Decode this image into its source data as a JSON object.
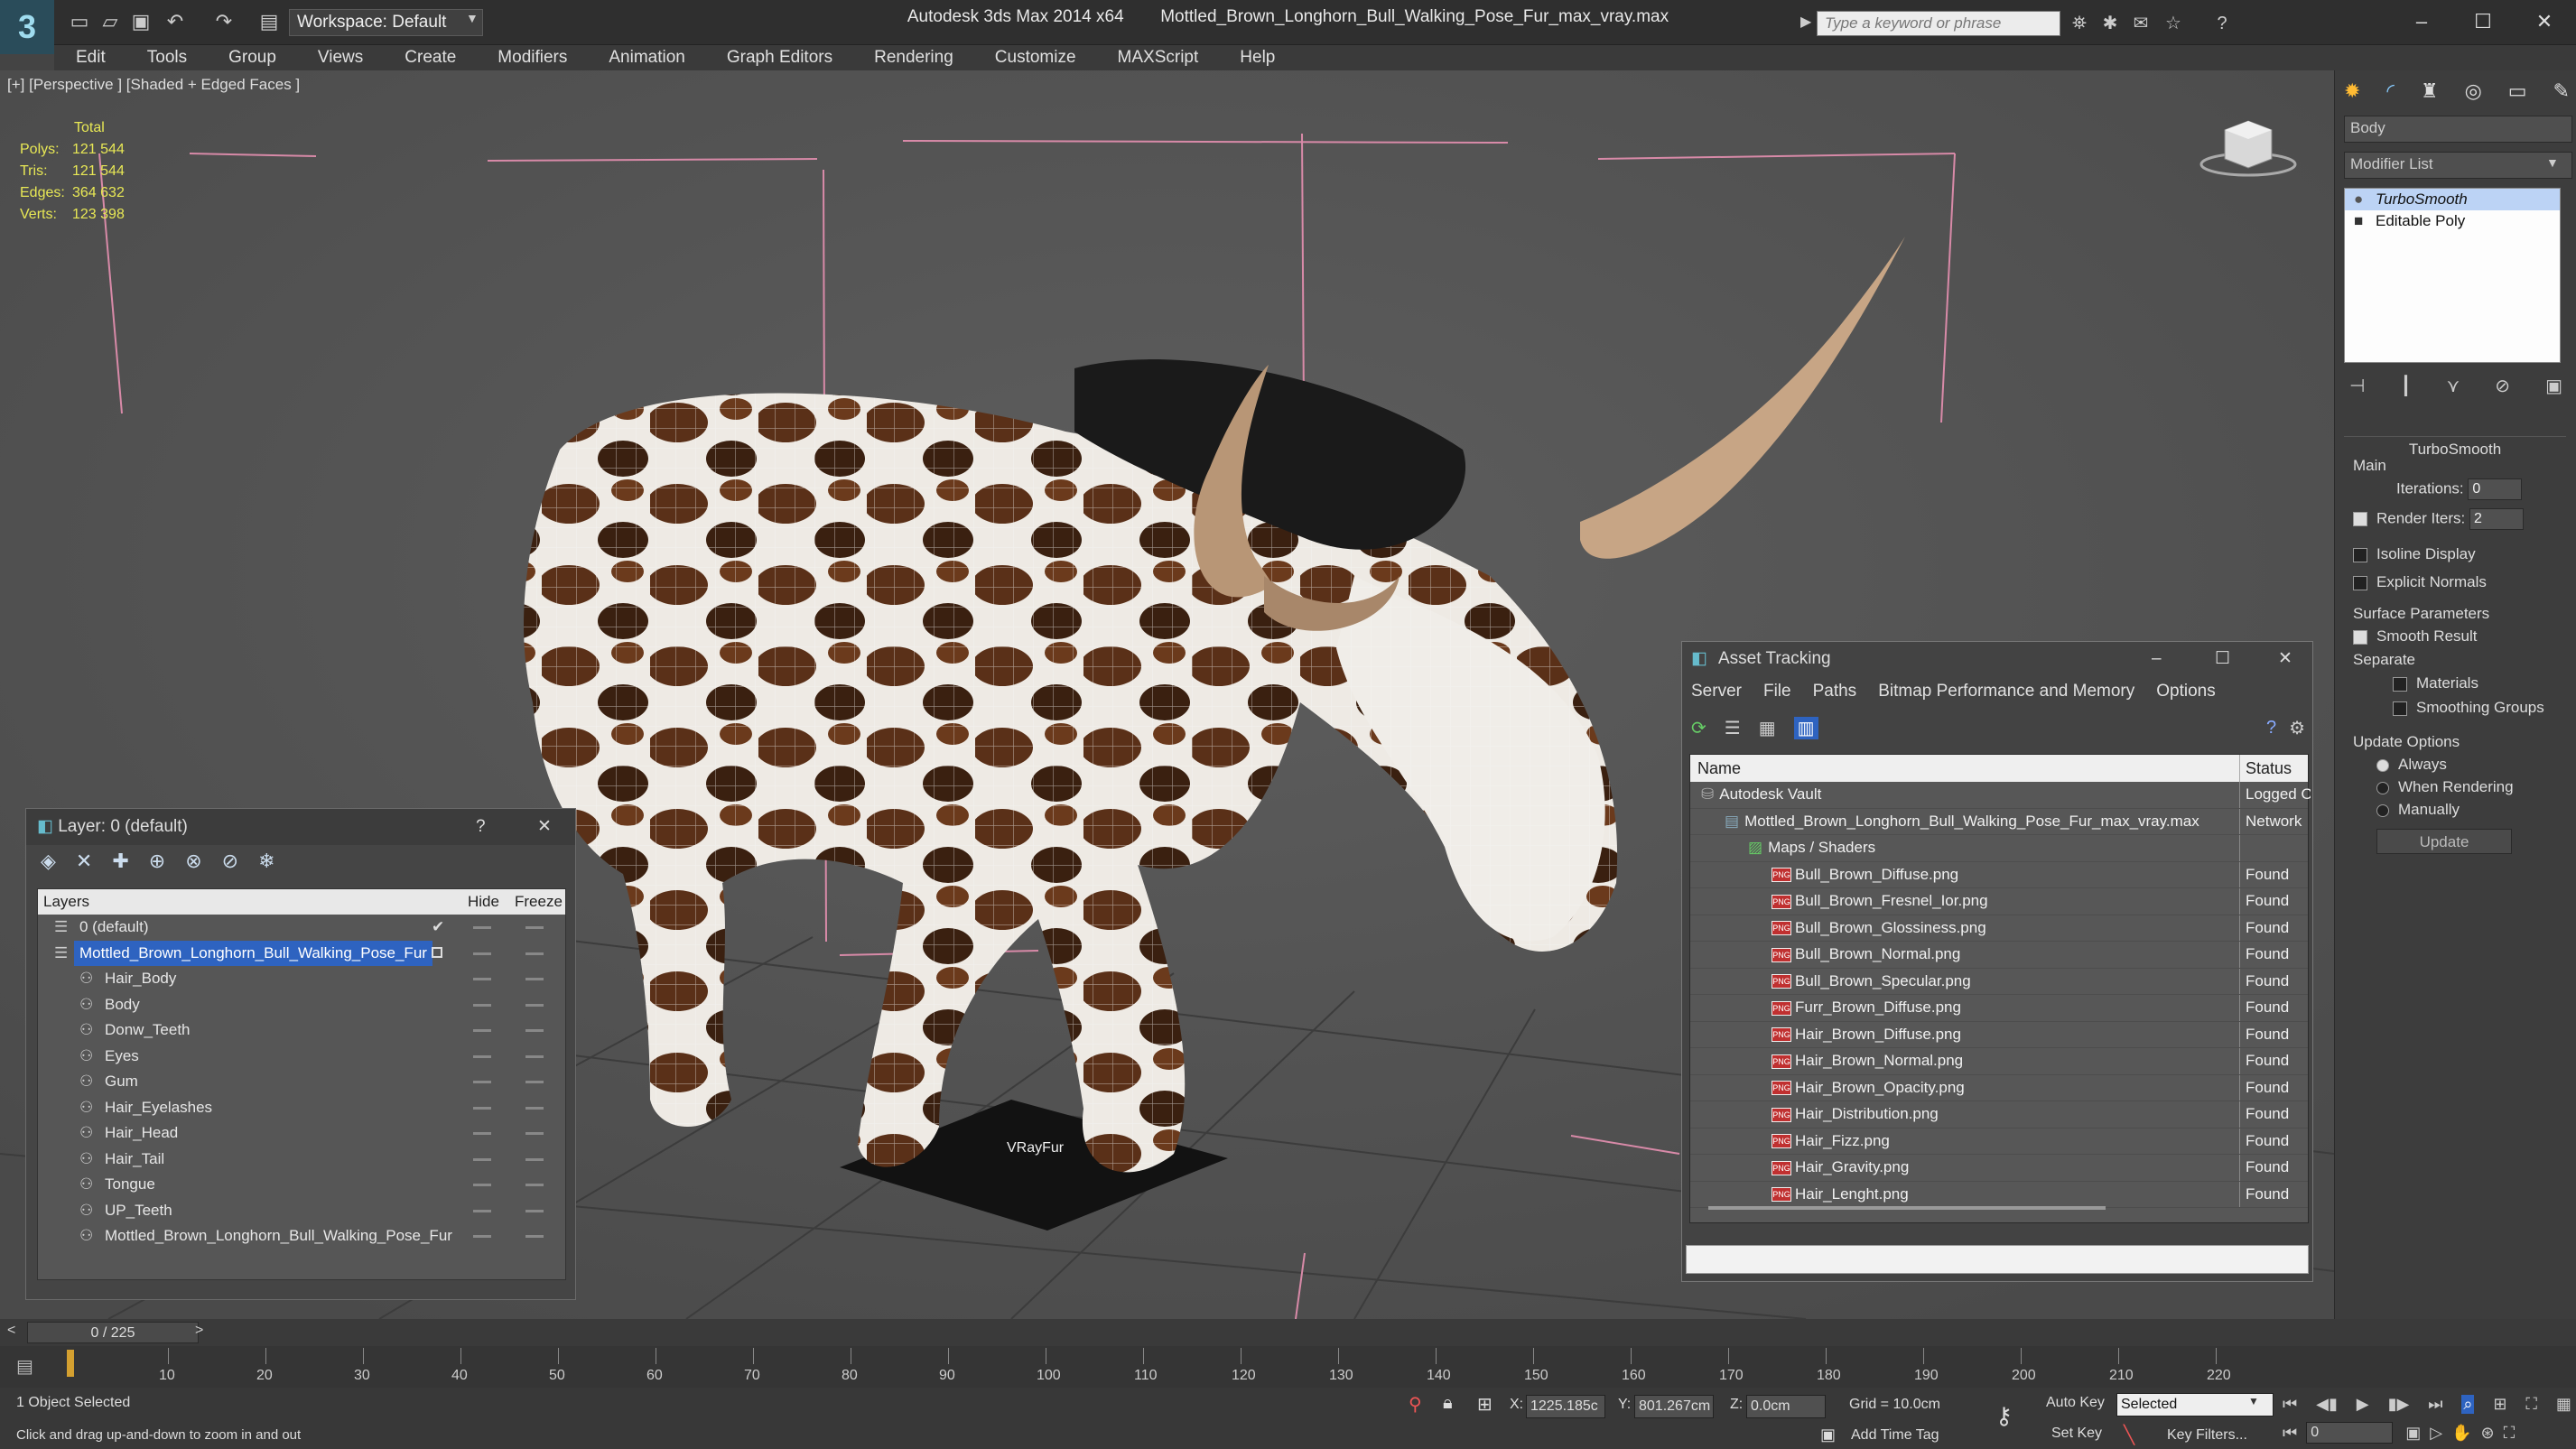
{
  "app": {
    "title": "Autodesk 3ds Max  2014 x64",
    "file": "Mottled_Brown_Longhorn_Bull_Walking_Pose_Fur_max_vray.max",
    "workspace": "Workspace: Default",
    "search_placeholder": "Type a keyword or phrase"
  },
  "menu": [
    "Edit",
    "Tools",
    "Group",
    "Views",
    "Create",
    "Modifiers",
    "Animation",
    "Graph Editors",
    "Rendering",
    "Customize",
    "MAXScript",
    "Help"
  ],
  "viewport": {
    "label": "[+] [Perspective ] [Shaded + Edged Faces ]",
    "stats_header": "Total",
    "stats": [
      {
        "k": "Polys:",
        "v": "121 544"
      },
      {
        "k": "Tris:",
        "v": "121 544"
      },
      {
        "k": "Edges:",
        "v": "364 632"
      },
      {
        "k": "Verts:",
        "v": "123 398"
      }
    ],
    "ground_label": "VRayFur"
  },
  "layer_explorer": {
    "title": "Layer: 0 (default)",
    "help": "?",
    "col_layers": "Layers",
    "col_hide": "Hide",
    "col_freeze": "Freeze",
    "rows": [
      {
        "name": "0 (default)",
        "level": 0,
        "checked": true
      },
      {
        "name": "Mottled_Brown_Longhorn_Bull_Walking_Pose_Fur",
        "level": 0,
        "selected": true
      },
      {
        "name": "Hair_Body",
        "level": 1
      },
      {
        "name": "Body",
        "level": 1
      },
      {
        "name": "Donw_Teeth",
        "level": 1
      },
      {
        "name": "Eyes",
        "level": 1
      },
      {
        "name": "Gum",
        "level": 1
      },
      {
        "name": "Hair_Eyelashes",
        "level": 1
      },
      {
        "name": "Hair_Head",
        "level": 1
      },
      {
        "name": "Hair_Tail",
        "level": 1
      },
      {
        "name": "Tongue",
        "level": 1
      },
      {
        "name": "UP_Teeth",
        "level": 1
      },
      {
        "name": "Mottled_Brown_Longhorn_Bull_Walking_Pose_Fur",
        "level": 1
      }
    ]
  },
  "command_panel": {
    "object_name": "Body",
    "modifier_list": "Modifier List",
    "stack": [
      {
        "name": "TurboSmooth",
        "active": true
      },
      {
        "name": "Editable Poly",
        "active": false
      }
    ],
    "rollout_title": "TurboSmooth",
    "main_label": "Main",
    "iterations_label": "Iterations:",
    "iterations_value": "0",
    "render_iters_label": "Render Iters:",
    "render_iters_value": "2",
    "isoline": "Isoline Display",
    "explicit_normals": "Explicit Normals",
    "surface_params": "Surface Parameters",
    "smooth_result": "Smooth Result",
    "separate": "Separate",
    "materials": "Materials",
    "smoothing_groups": "Smoothing Groups",
    "update_options": "Update Options",
    "always": "Always",
    "when_rendering": "When Rendering",
    "manually": "Manually",
    "update_button": "Update"
  },
  "asset_tracking": {
    "title": "Asset Tracking",
    "menu": [
      "Server",
      "File",
      "Paths",
      "Bitmap Performance and Memory",
      "Options"
    ],
    "col_name": "Name",
    "col_status": "Status",
    "rows": [
      {
        "name": "Autodesk Vault",
        "status": "Logged O",
        "level": 1,
        "icon": "vault"
      },
      {
        "name": "Mottled_Brown_Longhorn_Bull_Walking_Pose_Fur_max_vray.max",
        "status": "Network",
        "level": 2,
        "icon": "max"
      },
      {
        "name": "Maps / Shaders",
        "status": "",
        "level": 3,
        "icon": "maps"
      },
      {
        "name": "Bull_Brown_Diffuse.png",
        "status": "Found",
        "level": 4,
        "icon": "png"
      },
      {
        "name": "Bull_Brown_Fresnel_Ior.png",
        "status": "Found",
        "level": 4,
        "icon": "png"
      },
      {
        "name": "Bull_Brown_Glossiness.png",
        "status": "Found",
        "level": 4,
        "icon": "png"
      },
      {
        "name": "Bull_Brown_Normal.png",
        "status": "Found",
        "level": 4,
        "icon": "png"
      },
      {
        "name": "Bull_Brown_Specular.png",
        "status": "Found",
        "level": 4,
        "icon": "png"
      },
      {
        "name": "Furr_Brown_Diffuse.png",
        "status": "Found",
        "level": 4,
        "icon": "png"
      },
      {
        "name": "Hair_Brown_Diffuse.png",
        "status": "Found",
        "level": 4,
        "icon": "png"
      },
      {
        "name": "Hair_Brown_Normal.png",
        "status": "Found",
        "level": 4,
        "icon": "png"
      },
      {
        "name": "Hair_Brown_Opacity.png",
        "status": "Found",
        "level": 4,
        "icon": "png"
      },
      {
        "name": "Hair_Distribution.png",
        "status": "Found",
        "level": 4,
        "icon": "png"
      },
      {
        "name": "Hair_Fizz.png",
        "status": "Found",
        "level": 4,
        "icon": "png"
      },
      {
        "name": "Hair_Gravity.png",
        "status": "Found",
        "level": 4,
        "icon": "png"
      },
      {
        "name": "Hair_Lenght.png",
        "status": "Found",
        "level": 4,
        "icon": "png"
      }
    ]
  },
  "timeline": {
    "frame": "0 / 225",
    "ticks": [
      "10",
      "20",
      "30",
      "40",
      "50",
      "60",
      "70",
      "80",
      "90",
      "100",
      "110",
      "120",
      "130",
      "140",
      "150",
      "160",
      "170",
      "180",
      "190",
      "200",
      "210",
      "220"
    ]
  },
  "status": {
    "selection": "1 Object Selected",
    "prompt": "Click and drag up-and-down to zoom in and out",
    "x_label": "X:",
    "x_value": "1225.185c",
    "y_label": "Y:",
    "y_value": "801.267cm",
    "z_label": "Z:",
    "z_value": "0.0cm",
    "grid": "Grid = 10.0cm",
    "add_time_tag": "Add Time Tag",
    "auto_key": "Auto Key",
    "set_key": "Set Key",
    "selected": "Selected",
    "key_filters": "Key Filters...",
    "frame_field": "0"
  },
  "colors": {
    "selection": "#2e63c0",
    "stats": "#e8e855",
    "grid_pink": "#d88aa8"
  }
}
